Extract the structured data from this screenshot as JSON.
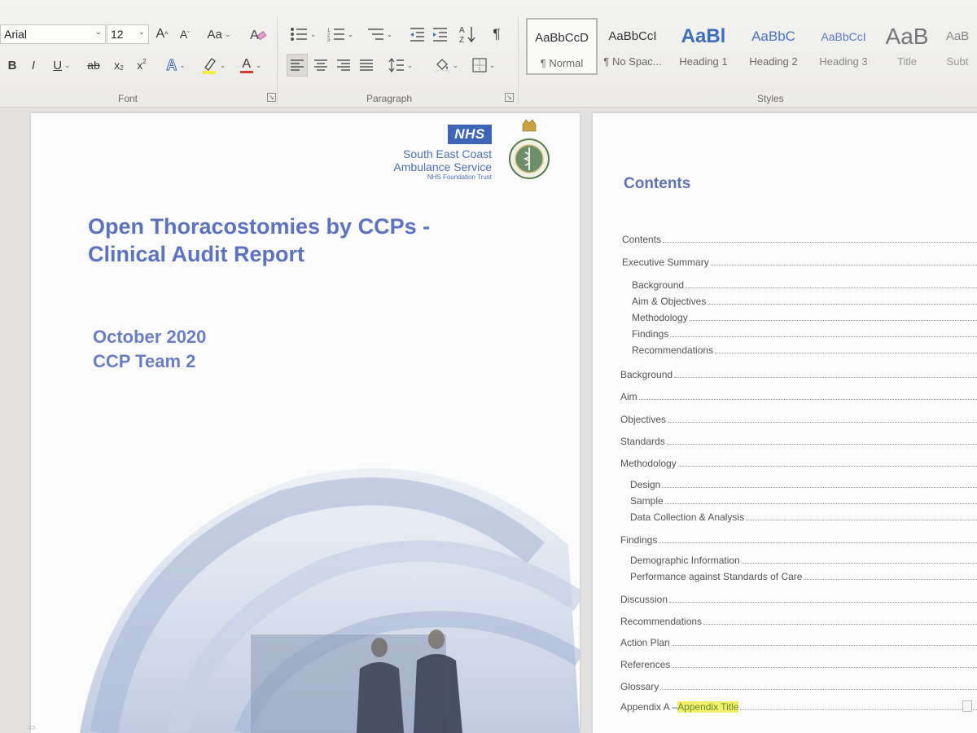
{
  "ribbon": {
    "font_name": "Arial",
    "font_size": "12",
    "grow_font": "A",
    "shrink_font": "A",
    "change_case": "Aa",
    "bold": "B",
    "italic": "I",
    "underline": "U",
    "strikethrough": "ab",
    "subscript": "x",
    "superscript": "x",
    "text_effects": "A",
    "font_color": "A",
    "sort": "A\nZ",
    "pilcrow": "¶",
    "group_font": "Font",
    "group_paragraph": "Paragraph",
    "group_styles": "Styles",
    "styles": [
      {
        "sample": "AaBbCcD",
        "name": "¶ Normal"
      },
      {
        "sample": "AaBbCcI",
        "name": "¶ No Spac..."
      },
      {
        "sample": "AaBl",
        "name": "Heading 1"
      },
      {
        "sample": "AaBbC",
        "name": "Heading 2"
      },
      {
        "sample": "AaBbCcI",
        "name": "Heading 3"
      },
      {
        "sample": "AaB",
        "name": "Title"
      },
      {
        "sample": "AaB",
        "name": "Subt"
      }
    ]
  },
  "cover": {
    "nhs": "NHS",
    "org_line1": "South East Coast",
    "org_line2": "Ambulance Service",
    "org_line3": "NHS Foundation Trust",
    "title_line1": "Open Thoracostomies by CCPs -",
    "title_line2": "Clinical Audit Report",
    "date": "October 2020",
    "team": "CCP Team 2"
  },
  "contents": {
    "heading": "Contents",
    "items": [
      {
        "text": "Contents"
      },
      {
        "text": "Executive Summary"
      },
      {
        "text": "Background"
      },
      {
        "text": "Aim & Objectives"
      },
      {
        "text": "Methodology"
      },
      {
        "text": "Findings"
      },
      {
        "text": "Recommendations"
      },
      {
        "text": "Background"
      },
      {
        "text": "Aim"
      },
      {
        "text": "Objectives"
      },
      {
        "text": "Standards"
      },
      {
        "text": "Methodology"
      },
      {
        "text": "Design"
      },
      {
        "text": "Sample"
      },
      {
        "text": "Data Collection & Analysis"
      },
      {
        "text": "Findings"
      },
      {
        "text": "Demographic Information"
      },
      {
        "text": "Performance against Standards of Care"
      },
      {
        "text": "Discussion"
      },
      {
        "text": "Recommendations"
      },
      {
        "text": "Action Plan"
      },
      {
        "text": "References"
      },
      {
        "text": "Glossary"
      },
      {
        "text": "Appendix A – ",
        "highlight": "Appendix Title"
      }
    ]
  },
  "colors": {
    "title_blue": "#5e73c0",
    "nhs_blue": "#3f65b8",
    "highlight": "#f2f06a"
  }
}
